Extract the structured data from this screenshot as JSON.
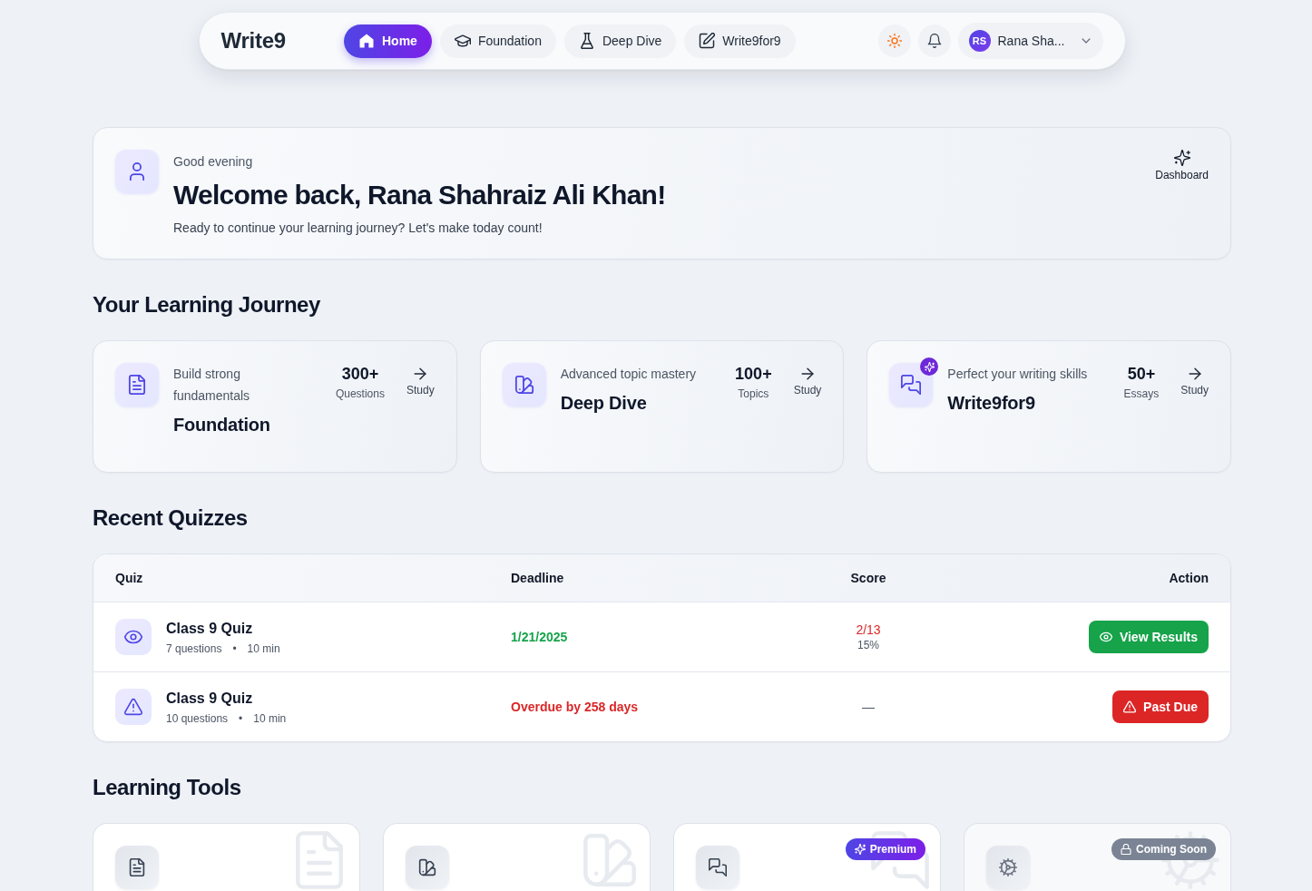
{
  "nav": {
    "logo": "Write9",
    "tabs": [
      {
        "label": "Home",
        "selected": true
      },
      {
        "label": "Foundation",
        "selected": false
      },
      {
        "label": "Deep Dive",
        "selected": false
      },
      {
        "label": "Write9for9",
        "selected": false
      }
    ],
    "user": {
      "initials": "RS",
      "name": "Rana Sha..."
    }
  },
  "welcome": {
    "greeting": "Good evening",
    "title": "Welcome back, Rana Shahraiz Ali Khan!",
    "subtitle": "Ready to continue your learning journey? Let's make today count!",
    "dashboard_label": "Dashboard"
  },
  "learning_journey": {
    "heading": "Your Learning Journey",
    "cards": [
      {
        "kind": "standard",
        "subtitle": "Build strong fundamentals",
        "title": "Foundation",
        "stat_value": "300+",
        "stat_label": "Questions",
        "action": "Study"
      },
      {
        "kind": "standard",
        "subtitle": "Advanced topic mastery",
        "title": "Deep Dive",
        "stat_value": "100+",
        "stat_label": "Topics",
        "action": "Study"
      },
      {
        "kind": "premium",
        "subtitle": "Perfect your writing skills",
        "title": "Write9for9",
        "stat_value": "50+",
        "stat_label": "Essays",
        "action": "Study"
      }
    ]
  },
  "recent_quizzes": {
    "heading": "Recent Quizzes",
    "columns": [
      "Quiz",
      "Deadline",
      "Score",
      "Action"
    ],
    "rows": [
      {
        "kind": "completed",
        "title": "Class 9 Quiz",
        "questions": "7 questions",
        "separator": "•",
        "duration": "10 min",
        "deadline": "1/21/2025",
        "score": "2/13",
        "percent": "15%",
        "action": "View Results"
      },
      {
        "kind": "overdue",
        "title": "Class 9 Quiz",
        "questions": "10 questions",
        "separator": "•",
        "duration": "10 min",
        "deadline": "Overdue by 258 days",
        "score": "—",
        "action": "Past Due"
      }
    ]
  },
  "learning_tools": {
    "heading": "Learning Tools",
    "cards": [
      {
        "kind": "standard"
      },
      {
        "kind": "standard"
      },
      {
        "kind": "premium",
        "badge": "Premium"
      },
      {
        "kind": "coming_soon",
        "badge": "Coming Soon"
      }
    ]
  }
}
